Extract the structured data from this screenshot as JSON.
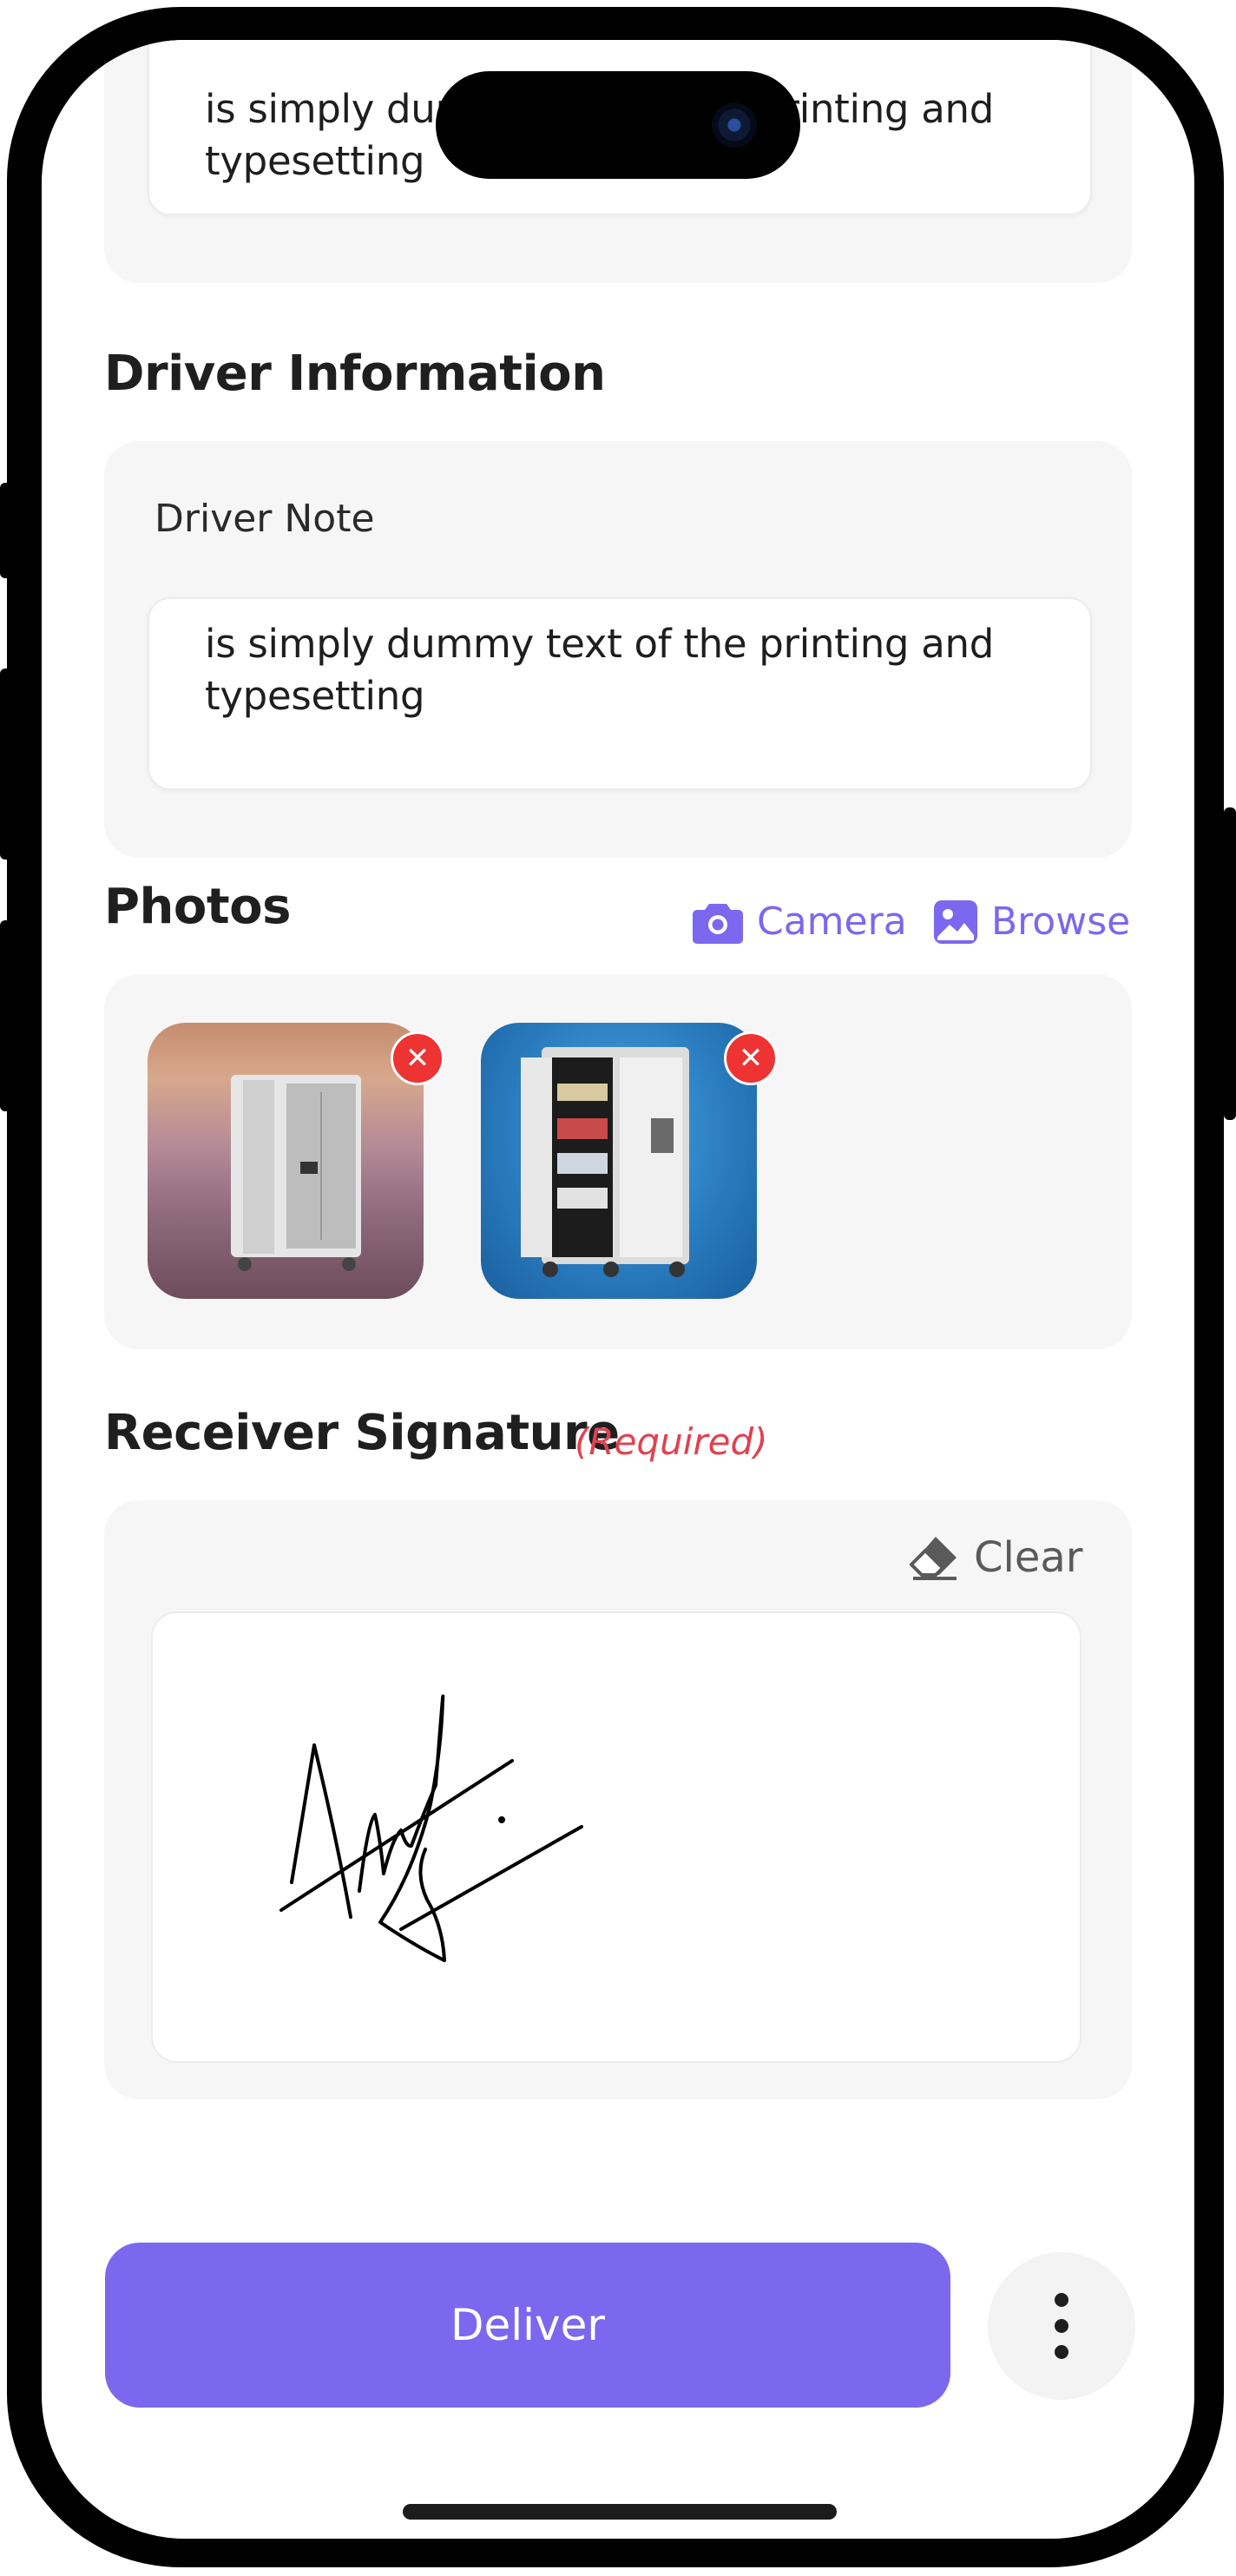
{
  "top_note": {
    "value": "is simply dummy text of the printing and typesetting"
  },
  "driver_information": {
    "title": "Driver Information",
    "note_label": "Driver Note",
    "note_value": "is simply dummy text of the printing and typesetting"
  },
  "photos": {
    "title": "Photos",
    "camera_label": "Camera",
    "browse_label": "Browse",
    "items": [
      {
        "icon": "remove-icon",
        "remove_glyph": "✕"
      },
      {
        "icon": "remove-icon",
        "remove_glyph": "✕"
      }
    ]
  },
  "signature": {
    "title": "Receiver Signature",
    "required_label": "(Required)",
    "clear_label": "Clear"
  },
  "footer": {
    "deliver_label": "Deliver",
    "more_icon": "more-vertical-icon"
  },
  "colors": {
    "accent": "#7b68ee",
    "danger": "#e0424e",
    "card_bg": "#f6f6f6"
  }
}
